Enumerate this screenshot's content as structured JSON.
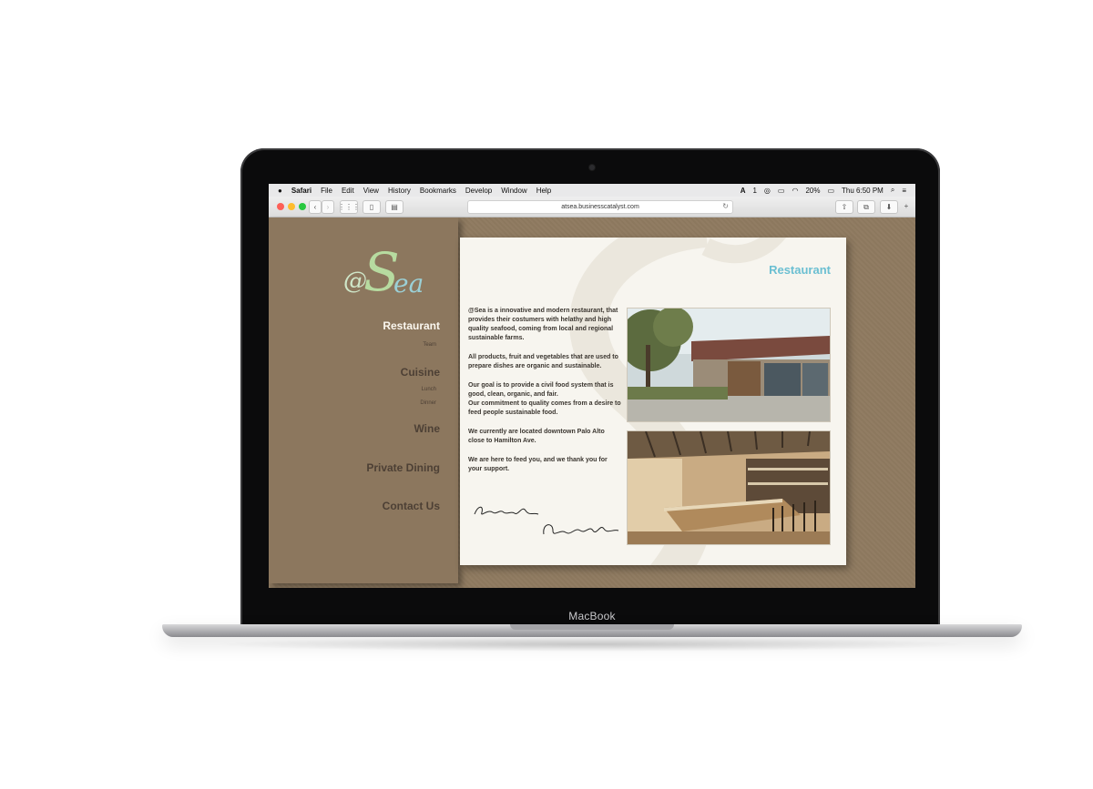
{
  "device": {
    "label": "MacBook"
  },
  "menubar": {
    "apple_glyph": "",
    "items": [
      "Safari",
      "File",
      "Edit",
      "View",
      "History",
      "Bookmarks",
      "Develop",
      "Window",
      "Help"
    ],
    "status": {
      "adobe_count": "1",
      "battery": "20%",
      "clock": "Thu 6:50 PM"
    }
  },
  "browser": {
    "url": "atsea.businesscatalyst.com"
  },
  "site": {
    "logo_text": "@Sea",
    "nav": [
      {
        "label": "Restaurant",
        "active": true
      },
      {
        "label": "Team",
        "sub": true
      },
      {
        "label": "Cuisine"
      },
      {
        "label": "Lunch",
        "sub": true
      },
      {
        "label": "Dinner",
        "sub": true
      },
      {
        "label": "Wine"
      },
      {
        "label": "Private Dining"
      },
      {
        "label": "Contact Us"
      }
    ]
  },
  "main": {
    "title": "Restaurant",
    "paragraphs": [
      "@Sea is a innovative and modern restaurant, that provides their costumers with helathy and high quality seafood, coming from local and regional sustainable farms.",
      "All products, fruit and vegetables that are used to prepare dishes are organic and sustainable.",
      "Our goal is to provide a civil food system that is good, clean, organic, and fair.\nOur commitment to quality comes from a desire to feed people sustainable food.",
      "We currently are located downtown Palo Alto close to Hamilton Ave.",
      "We are here to feed you, and we thank you for your support."
    ],
    "signature_1": "Paloma Miller",
    "signature_2": "Aleandro Daniels"
  },
  "colors": {
    "accent": "#6bbfd2",
    "nav_active": "#fbf7ef",
    "nav": "#4d4035",
    "kraft": "#8f7a60"
  }
}
